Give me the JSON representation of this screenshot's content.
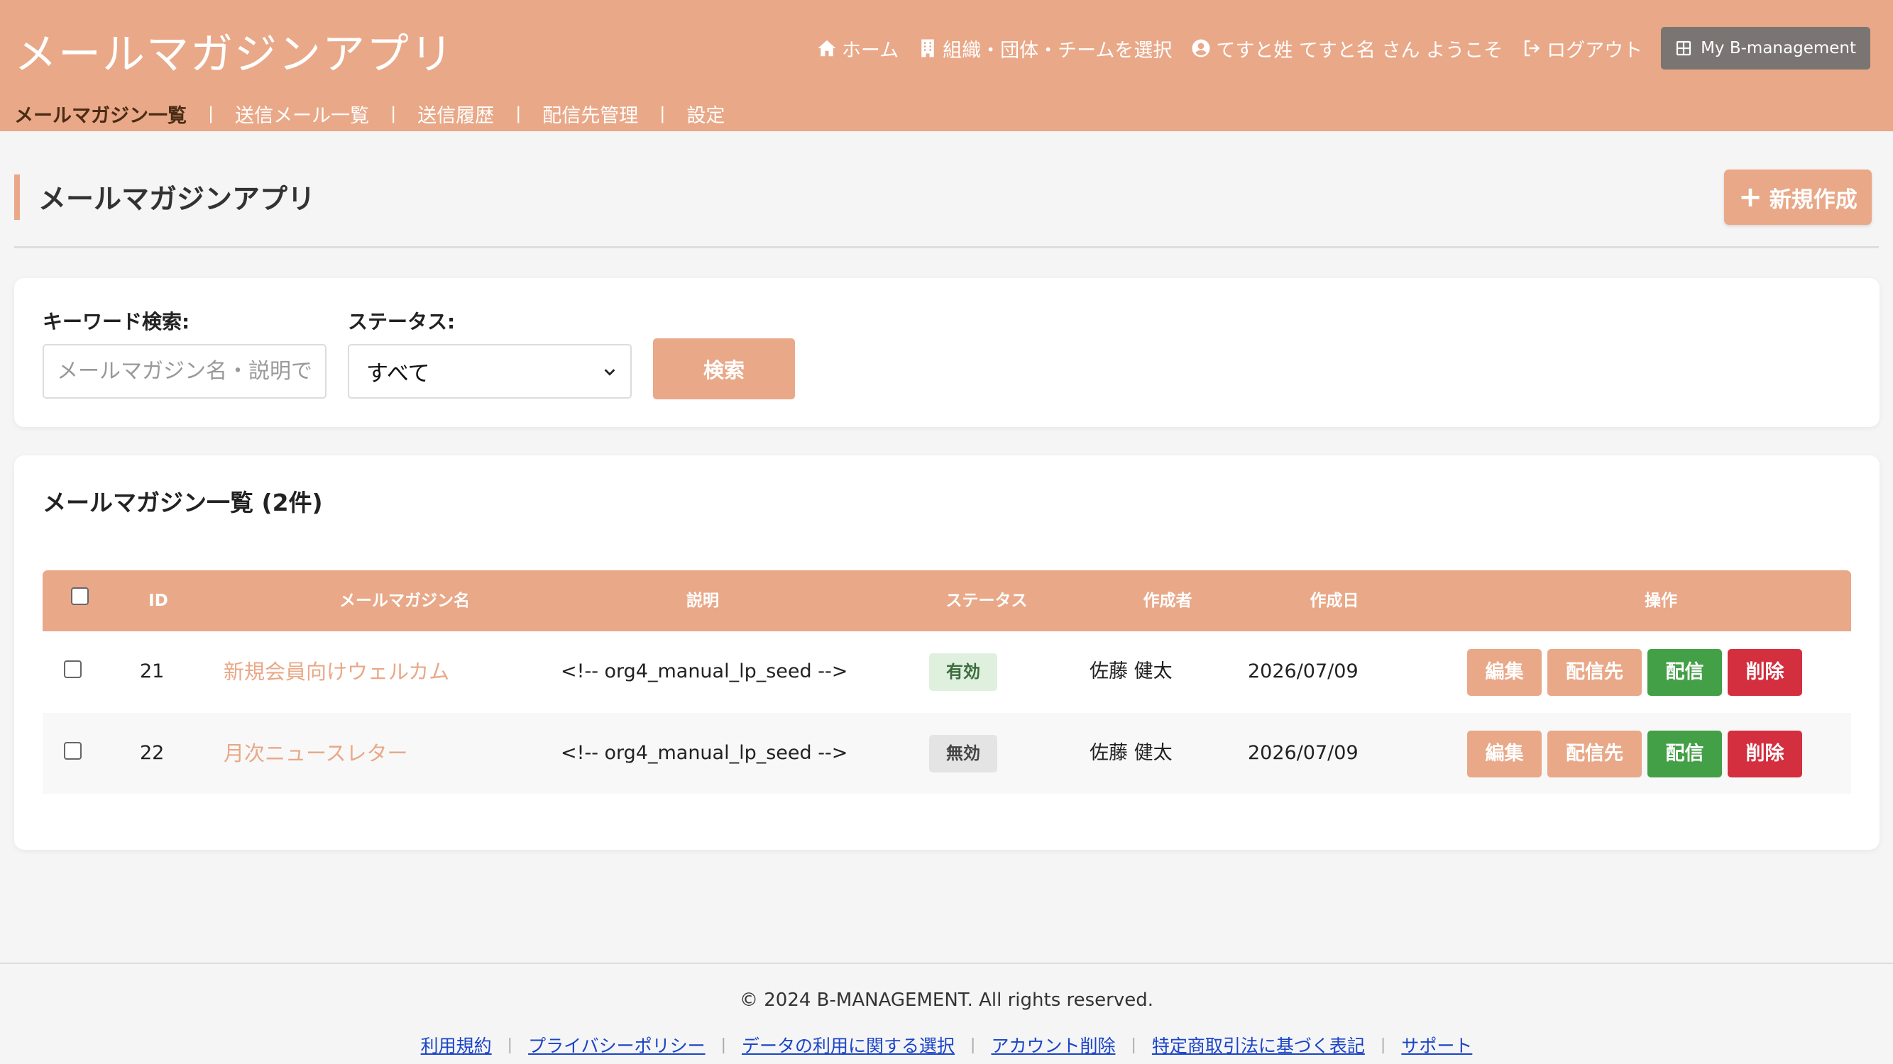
{
  "header": {
    "app_title": "メールマガジンアプリ",
    "nav": {
      "home": "ホーム",
      "select_org": "組織・団体・チームを選択",
      "user_greeting": "てすと姓 てすと名 さん ようこそ",
      "logout": "ログアウト",
      "my_bmanagement": "My B-management"
    },
    "subnav": {
      "items": [
        "メールマガジン一覧",
        "送信メール一覧",
        "送信履歴",
        "配信先管理",
        "設定"
      ],
      "separator": "|"
    }
  },
  "page": {
    "heading": "メールマガジンアプリ",
    "new_button_label": "新規作成",
    "new_button_icon": "+"
  },
  "search": {
    "keyword_label": "キーワード検索:",
    "keyword_placeholder": "メールマガジン名・説明で検索",
    "keyword_value": "",
    "status_label": "ステータス:",
    "status_value": "すべて",
    "search_button": "検索"
  },
  "list": {
    "title": "メールマガジン一覧 (2件)",
    "columns": {
      "id": "ID",
      "name": "メールマガジン名",
      "description": "説明",
      "status": "ステータス",
      "author": "作成者",
      "created": "作成日",
      "actions": "操作"
    },
    "action_labels": {
      "edit": "編集",
      "recipients": "配信先",
      "deliver": "配信",
      "delete": "削除"
    },
    "rows": [
      {
        "id": "21",
        "name": "新規会員向けウェルカム",
        "description": "<!-- org4_manual_lp_seed -->",
        "status": "有効",
        "author": "佐藤 健太",
        "created": "2026/07/09"
      },
      {
        "id": "22",
        "name": "月次ニュースレター",
        "description": "<!-- org4_manual_lp_seed -->",
        "status": "無効",
        "author": "佐藤 健太",
        "created": "2026/07/09"
      }
    ]
  },
  "footer": {
    "copyright": "© 2024 B-MANAGEMENT. All rights reserved.",
    "links": [
      "利用規約",
      "プライバシーポリシー",
      "データの利用に関する選択",
      "アカウント削除",
      "特定商取引法に基づく表記",
      "サポート"
    ],
    "separator": "|"
  },
  "colors": {
    "accent": "#e9a888",
    "active_subnav": "#4a2c14",
    "deliver_green": "#43a047",
    "delete_red": "#d32f3f",
    "link_blue": "#1a44c8"
  },
  "icons": {
    "home": "home-icon",
    "org": "building-icon",
    "user": "user-circle-icon",
    "logout": "logout-icon",
    "grid": "grid-icon",
    "dropdown": "chevron-down-icon"
  }
}
